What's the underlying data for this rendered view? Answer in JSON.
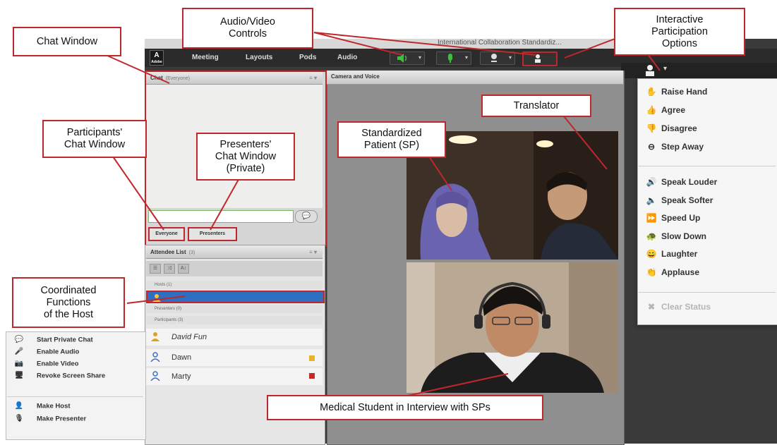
{
  "app": {
    "title": "International Collaboration Standardiz...",
    "logo_text": "Adobe",
    "menu": [
      "Meeting",
      "Layouts",
      "Pods",
      "Audio"
    ]
  },
  "chat_pod": {
    "title": "Chat",
    "subtitle": "(Everyone)",
    "tabs": [
      "Everyone",
      "Presenters"
    ],
    "send_icon": "speech-bubble-icon"
  },
  "attendee_pod": {
    "title": "Attendee List",
    "count": "(3)",
    "groups": {
      "hosts": "Hosts (1)",
      "presenters": "Presenters (0)",
      "participants": "Participants (3)"
    },
    "people": [
      {
        "name": "David Fun",
        "status": ""
      },
      {
        "name": "Dawn",
        "status": "agree"
      },
      {
        "name": "Marty",
        "status": "disagree"
      }
    ]
  },
  "camera_pod": {
    "title": "Camera and Voice"
  },
  "status_menu": {
    "items_group1": [
      {
        "label": "Raise Hand",
        "icon": "raise-hand-icon"
      },
      {
        "label": "Agree",
        "icon": "thumbs-up-icon"
      },
      {
        "label": "Disagree",
        "icon": "thumbs-down-icon"
      },
      {
        "label": "Step Away",
        "icon": "step-away-icon"
      }
    ],
    "items_group2": [
      {
        "label": "Speak Louder",
        "icon": "speaker-loud-icon"
      },
      {
        "label": "Speak Softer",
        "icon": "speaker-soft-icon"
      },
      {
        "label": "Speed Up",
        "icon": "speed-up-icon"
      },
      {
        "label": "Slow Down",
        "icon": "slow-down-icon"
      },
      {
        "label": "Laughter",
        "icon": "laughter-icon"
      },
      {
        "label": "Applause",
        "icon": "applause-icon"
      }
    ],
    "clear": "Clear Status"
  },
  "context_menu": {
    "items_group1": [
      "Start Private Chat",
      "Enable Audio",
      "Enable Video",
      "Revoke Screen Share"
    ],
    "items_group2": [
      "Make Host",
      "Make Presenter"
    ]
  },
  "callouts": {
    "chat_window": "Chat Window",
    "av_controls": "Audio/Video\nControls",
    "interactive": "Interactive\nParticipation\nOptions",
    "participants_chat": "Participants'\nChat Window",
    "presenters_chat": "Presenters'\nChat Window\n(Private)",
    "sp": "Standardized\nPatient (SP)",
    "translator": "Translator",
    "host": "Coordinated\nFunctions\nof the Host",
    "student": "Medical Student in Interview with SPs"
  },
  "colors": {
    "accent": "#c0272d",
    "selection": "#2f6fc2",
    "bg": "#3a3a3a"
  }
}
